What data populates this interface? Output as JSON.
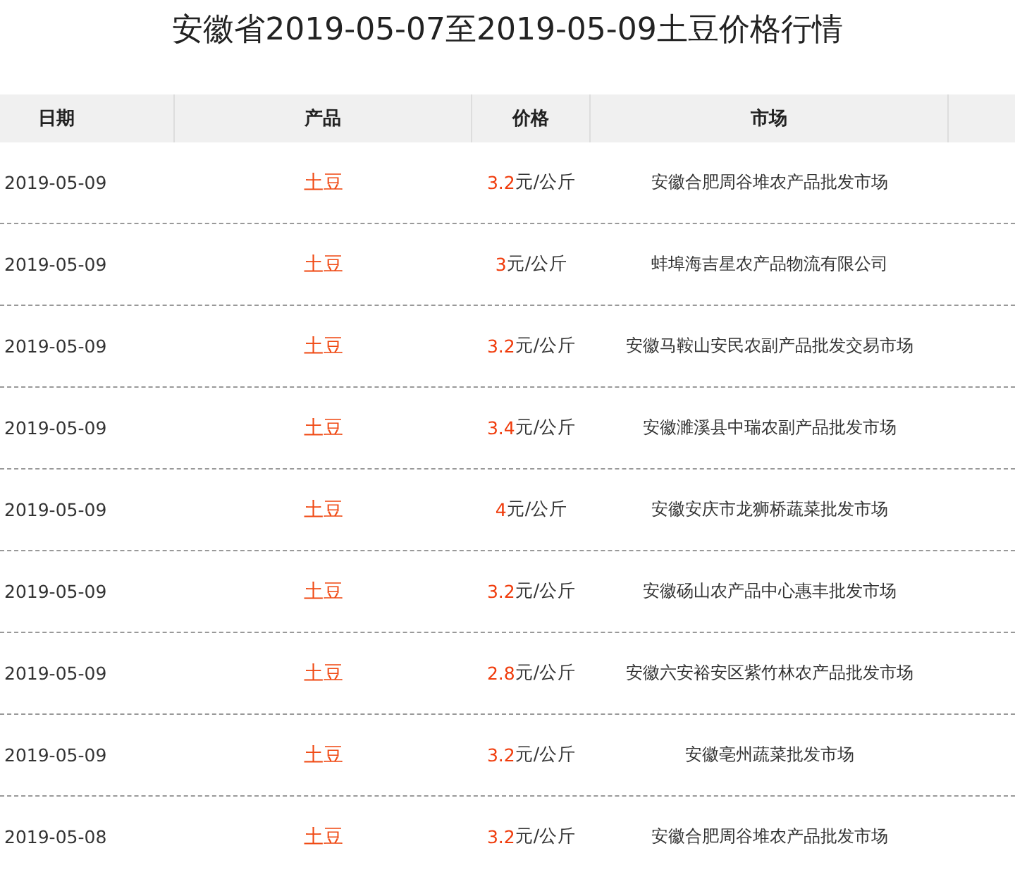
{
  "title": "安徽省2019-05-07至2019-05-09土豆价格行情",
  "table": {
    "columns": [
      "日期",
      "产品",
      "价格",
      "市场"
    ],
    "rows": [
      {
        "date": "2019-05-09",
        "product": "土豆",
        "price": "3.2",
        "unit": "元/公斤",
        "market": "安徽合肥周谷堆农产品批发市场"
      },
      {
        "date": "2019-05-09",
        "product": "土豆",
        "price": "3",
        "unit": "元/公斤",
        "market": "蚌埠海吉星农产品物流有限公司"
      },
      {
        "date": "2019-05-09",
        "product": "土豆",
        "price": "3.2",
        "unit": "元/公斤",
        "market": "安徽马鞍山安民农副产品批发交易市场"
      },
      {
        "date": "2019-05-09",
        "product": "土豆",
        "price": "3.4",
        "unit": "元/公斤",
        "market": "安徽濉溪县中瑞农副产品批发市场"
      },
      {
        "date": "2019-05-09",
        "product": "土豆",
        "price": "4",
        "unit": "元/公斤",
        "market": "安徽安庆市龙狮桥蔬菜批发市场"
      },
      {
        "date": "2019-05-09",
        "product": "土豆",
        "price": "3.2",
        "unit": "元/公斤",
        "market": "安徽砀山农产品中心惠丰批发市场"
      },
      {
        "date": "2019-05-09",
        "product": "土豆",
        "price": "2.8",
        "unit": "元/公斤",
        "market": "安徽六安裕安区紫竹林农产品批发市场"
      },
      {
        "date": "2019-05-09",
        "product": "土豆",
        "price": "3.2",
        "unit": "元/公斤",
        "market": "安徽亳州蔬菜批发市场"
      },
      {
        "date": "2019-05-08",
        "product": "土豆",
        "price": "3.2",
        "unit": "元/公斤",
        "market": "安徽合肥周谷堆农产品批发市场"
      }
    ]
  }
}
